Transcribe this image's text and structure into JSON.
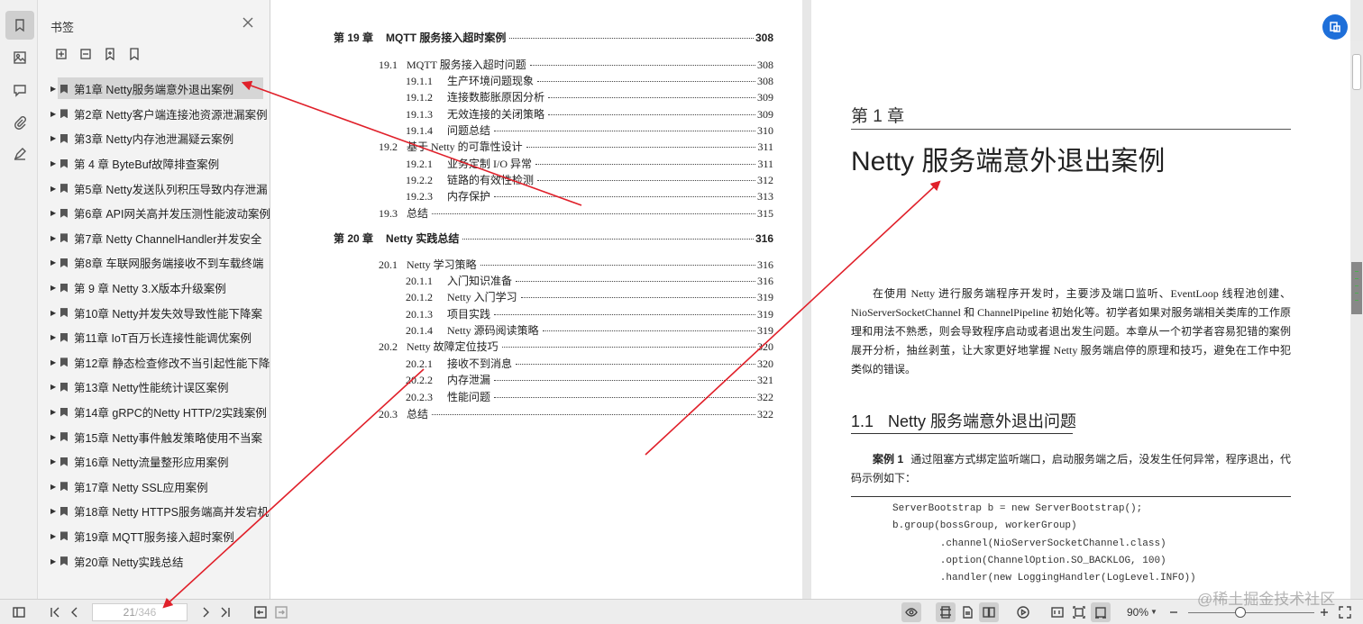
{
  "panel": {
    "title": "书签",
    "tools": [
      "expand-all-icon",
      "collapse-all-icon",
      "add-bookmark-icon",
      "bookmark-outline-icon"
    ]
  },
  "rail": [
    "bookmark-icon",
    "image-icon",
    "comment-icon",
    "attachment-icon",
    "signature-icon"
  ],
  "bookmarks": [
    "第1章 Netty服务端意外退出案例",
    "第2章 Netty客户端连接池资源泄漏案例",
    "第3章 Netty内存池泄漏疑云案例",
    "第 4 章 ByteBuf故障排查案例",
    "第5章 Netty发送队列积压导致内存泄漏",
    "第6章 API网关高并发压测性能波动案例",
    "第7章 Netty ChannelHandler并发安全",
    "第8章 车联网服务端接收不到车载终端",
    "第 9 章 Netty 3.X版本升级案例",
    "第10章 Netty并发失效导致性能下降案",
    "第11章 IoT百万长连接性能调优案例",
    "第12章 静态检查修改不当引起性能下降",
    "第13章 Netty性能统计误区案例",
    "第14章 gRPC的Netty HTTP/2实践案例",
    "第15章 Netty事件触发策略使用不当案",
    "第16章 Netty流量整形应用案例",
    "第17章 Netty SSL应用案例",
    "第18章 Netty HTTPS服务端高并发宕机",
    "第19章 MQTT服务接入超时案例",
    "第20章 Netty实践总结"
  ],
  "toc": [
    {
      "num": "第 19 章",
      "title": "MQTT 服务接入超时案例",
      "page": "308",
      "level": 0
    },
    {
      "num": "19.1",
      "title": "MQTT 服务接入超时问题",
      "page": "308",
      "level": 1
    },
    {
      "num": "19.1.1",
      "title": "生产环境问题现象",
      "page": "308",
      "level": 2
    },
    {
      "num": "19.1.2",
      "title": "连接数膨胀原因分析",
      "page": "309",
      "level": 2
    },
    {
      "num": "19.1.3",
      "title": "无效连接的关闭策略",
      "page": "309",
      "level": 2
    },
    {
      "num": "19.1.4",
      "title": "问题总结",
      "page": "310",
      "level": 2
    },
    {
      "num": "19.2",
      "title": "基于 Netty 的可靠性设计",
      "page": "311",
      "level": 1
    },
    {
      "num": "19.2.1",
      "title": "业务定制 I/O 异常",
      "page": "311",
      "level": 2
    },
    {
      "num": "19.2.2",
      "title": "链路的有效性检测",
      "page": "312",
      "level": 2
    },
    {
      "num": "19.2.3",
      "title": "内存保护",
      "page": "313",
      "level": 2
    },
    {
      "num": "19.3",
      "title": "总结",
      "page": "315",
      "level": 1
    },
    {
      "num": "第 20 章",
      "title": "Netty 实践总结",
      "page": "316",
      "level": 0
    },
    {
      "num": "20.1",
      "title": "Netty 学习策略",
      "page": "316",
      "level": 1
    },
    {
      "num": "20.1.1",
      "title": "入门知识准备",
      "page": "316",
      "level": 2
    },
    {
      "num": "20.1.2",
      "title": "Netty 入门学习",
      "page": "319",
      "level": 2
    },
    {
      "num": "20.1.3",
      "title": "项目实践",
      "page": "319",
      "level": 2
    },
    {
      "num": "20.1.4",
      "title": "Netty 源码阅读策略",
      "page": "319",
      "level": 2
    },
    {
      "num": "20.2",
      "title": "Netty 故障定位技巧",
      "page": "320",
      "level": 1
    },
    {
      "num": "20.2.1",
      "title": "接收不到消息",
      "page": "320",
      "level": 2
    },
    {
      "num": "20.2.2",
      "title": "内存泄漏",
      "page": "321",
      "level": 2
    },
    {
      "num": "20.2.3",
      "title": "性能问题",
      "page": "322",
      "level": 2
    },
    {
      "num": "20.3",
      "title": "总结",
      "page": "322",
      "level": 1
    }
  ],
  "chapter": {
    "number": "第 1 章",
    "title": "Netty 服务端意外退出案例",
    "intro": "在使用 Netty 进行服务端程序开发时，主要涉及端口监听、EventLoop 线程池创建、NioServerSocketChannel 和 ChannelPipeline 初始化等。初学者如果对服务端相关类库的工作原理和用法不熟悉，则会导致程序启动或者退出发生问题。本章从一个初学者容易犯错的案例展开分析，抽丝剥茧，让大家更好地掌握 Netty 服务端启停的原理和技巧，避免在工作中犯类似的错误。",
    "section_no": "1.1",
    "section_title": "Netty 服务端意外退出问题",
    "case_label": "案例 1",
    "case_text": "通过阻塞方式绑定监听端口，启动服务端之后，没发生任何异常，程序退出，代码示例如下：",
    "code": [
      "ServerBootstrap b = new ServerBootstrap();",
      "b.group(bossGroup, workerGroup)",
      "        .channel(NioServerSocketChannel.class)",
      "        .option(ChannelOption.SO_BACKLOG, 100)",
      "        .handler(new LoggingHandler(LogLevel.INFO))"
    ]
  },
  "pager": {
    "current": "21",
    "total": "/346"
  },
  "zoom": {
    "value": "90%"
  },
  "watermark": "@稀土掘金技术社区",
  "colors": {
    "accent": "#1e6fd9",
    "arrow": "#e0202a",
    "selected": "#d6d6d6"
  }
}
